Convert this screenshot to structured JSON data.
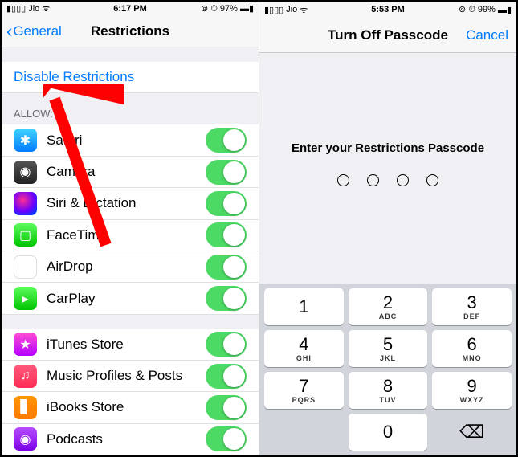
{
  "left": {
    "status": {
      "carrier": "Jio",
      "time": "6:17 PM",
      "battery": "97%"
    },
    "nav": {
      "back": "General",
      "title": "Restrictions"
    },
    "disable": "Disable Restrictions",
    "allow_header": "ALLOW:",
    "apps": [
      {
        "label": "Safari"
      },
      {
        "label": "Camera"
      },
      {
        "label": "Siri & Dictation"
      },
      {
        "label": "FaceTime"
      },
      {
        "label": "AirDrop"
      },
      {
        "label": "CarPlay"
      }
    ],
    "apps2": [
      {
        "label": "iTunes Store"
      },
      {
        "label": "Music Profiles & Posts"
      },
      {
        "label": "iBooks Store"
      },
      {
        "label": "Podcasts"
      }
    ]
  },
  "right": {
    "status": {
      "carrier": "Jio",
      "time": "5:53 PM",
      "battery": "99%"
    },
    "nav": {
      "title": "Turn Off Passcode",
      "cancel": "Cancel"
    },
    "prompt": "Enter your Restrictions Passcode",
    "keys": [
      {
        "n": "1",
        "s": ""
      },
      {
        "n": "2",
        "s": "ABC"
      },
      {
        "n": "3",
        "s": "DEF"
      },
      {
        "n": "4",
        "s": "GHI"
      },
      {
        "n": "5",
        "s": "JKL"
      },
      {
        "n": "6",
        "s": "MNO"
      },
      {
        "n": "7",
        "s": "PQRS"
      },
      {
        "n": "8",
        "s": "TUV"
      },
      {
        "n": "9",
        "s": "WXYZ"
      },
      {
        "n": "0",
        "s": ""
      }
    ]
  }
}
